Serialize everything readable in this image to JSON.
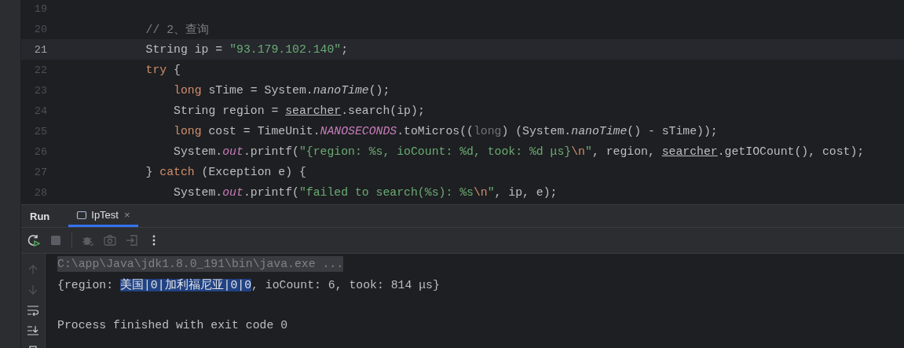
{
  "editor": {
    "lines": [
      {
        "number": "19",
        "current": false
      },
      {
        "number": "20",
        "current": false,
        "tokens": [
          {
            "text": "            // 2、查询",
            "kind": "comment"
          }
        ]
      },
      {
        "number": "21",
        "current": true,
        "tokens": [
          {
            "text": "            String ip = ",
            "kind": "plain"
          },
          {
            "text": "\"93.179.102.140\"",
            "kind": "string"
          },
          {
            "text": ";",
            "kind": "plain"
          }
        ]
      },
      {
        "number": "22",
        "current": false,
        "tokens": [
          {
            "text": "            try",
            "kind": "keyword"
          },
          {
            "text": " {",
            "kind": "plain"
          }
        ]
      },
      {
        "number": "23",
        "current": false,
        "tokens": [
          {
            "text": "                long",
            "kind": "keyword"
          },
          {
            "text": " sTime = System.",
            "kind": "plain"
          },
          {
            "text": "nanoTime",
            "kind": "static-method"
          },
          {
            "text": "();",
            "kind": "plain"
          }
        ]
      },
      {
        "number": "24",
        "current": false,
        "tokens": [
          {
            "text": "                String region = ",
            "kind": "plain"
          },
          {
            "text": "searcher",
            "kind": "underlined"
          },
          {
            "text": ".search(ip);",
            "kind": "plain"
          }
        ]
      },
      {
        "number": "25",
        "current": false,
        "tokens": [
          {
            "text": "                long",
            "kind": "keyword"
          },
          {
            "text": " cost = TimeUnit.",
            "kind": "plain"
          },
          {
            "text": "NANOSECONDS",
            "kind": "static-field"
          },
          {
            "text": ".toMicros((",
            "kind": "plain"
          },
          {
            "text": "long",
            "kind": "redundant"
          },
          {
            "text": ") (System.",
            "kind": "plain"
          },
          {
            "text": "nanoTime",
            "kind": "static-method"
          },
          {
            "text": "() - sTime));",
            "kind": "plain"
          }
        ]
      },
      {
        "number": "26",
        "current": false,
        "tokens": [
          {
            "text": "                System.",
            "kind": "plain"
          },
          {
            "text": "out",
            "kind": "static-field"
          },
          {
            "text": ".printf(",
            "kind": "plain"
          },
          {
            "text": "\"{region: %s, ioCount: %d, took: %d μs}",
            "kind": "string"
          },
          {
            "text": "\\n",
            "kind": "escape"
          },
          {
            "text": "\"",
            "kind": "string"
          },
          {
            "text": ", region, ",
            "kind": "plain"
          },
          {
            "text": "searcher",
            "kind": "underlined"
          },
          {
            "text": ".getIOCount(), cost);",
            "kind": "plain"
          }
        ]
      },
      {
        "number": "27",
        "current": false,
        "tokens": [
          {
            "text": "            } ",
            "kind": "plain"
          },
          {
            "text": "catch",
            "kind": "keyword"
          },
          {
            "text": " (Exception e) {",
            "kind": "plain"
          }
        ]
      },
      {
        "number": "28",
        "current": false,
        "tokens": [
          {
            "text": "                System.",
            "kind": "plain"
          },
          {
            "text": "out",
            "kind": "static-field"
          },
          {
            "text": ".printf(",
            "kind": "plain"
          },
          {
            "text": "\"failed to search(%s): %s",
            "kind": "string"
          },
          {
            "text": "\\n",
            "kind": "escape"
          },
          {
            "text": "\"",
            "kind": "string"
          },
          {
            "text": ", ip, e);",
            "kind": "plain"
          }
        ]
      }
    ]
  },
  "run_panel": {
    "title": "Run",
    "tabs": [
      {
        "label": "IpTest",
        "close": "×",
        "selected": true
      }
    ],
    "toolbar": [
      {
        "kind": "rerun",
        "disabled": false
      },
      {
        "kind": "stop",
        "disabled": true
      },
      {
        "kind": "debug",
        "disabled": true
      },
      {
        "kind": "camera",
        "disabled": true
      },
      {
        "kind": "exit",
        "disabled": true
      },
      {
        "kind": "more",
        "disabled": false
      }
    ],
    "console": {
      "lines": [
        {
          "kind": "command",
          "segments": [
            {
              "text": "C:\\app\\Java\\jdk1.8.0_191\\bin\\java.exe ...",
              "selected": false
            }
          ]
        },
        {
          "kind": "output",
          "segments": [
            {
              "text": "{region: ",
              "selected": false
            },
            {
              "text": "美国|0|加利福尼亚|0|0",
              "selected": true
            },
            {
              "text": ", ioCount: 6, took: 814 μs}",
              "selected": false
            }
          ]
        },
        {
          "kind": "blank"
        },
        {
          "kind": "output",
          "segments": [
            {
              "text": "Process finished with exit code 0",
              "selected": false
            }
          ]
        }
      ]
    }
  }
}
